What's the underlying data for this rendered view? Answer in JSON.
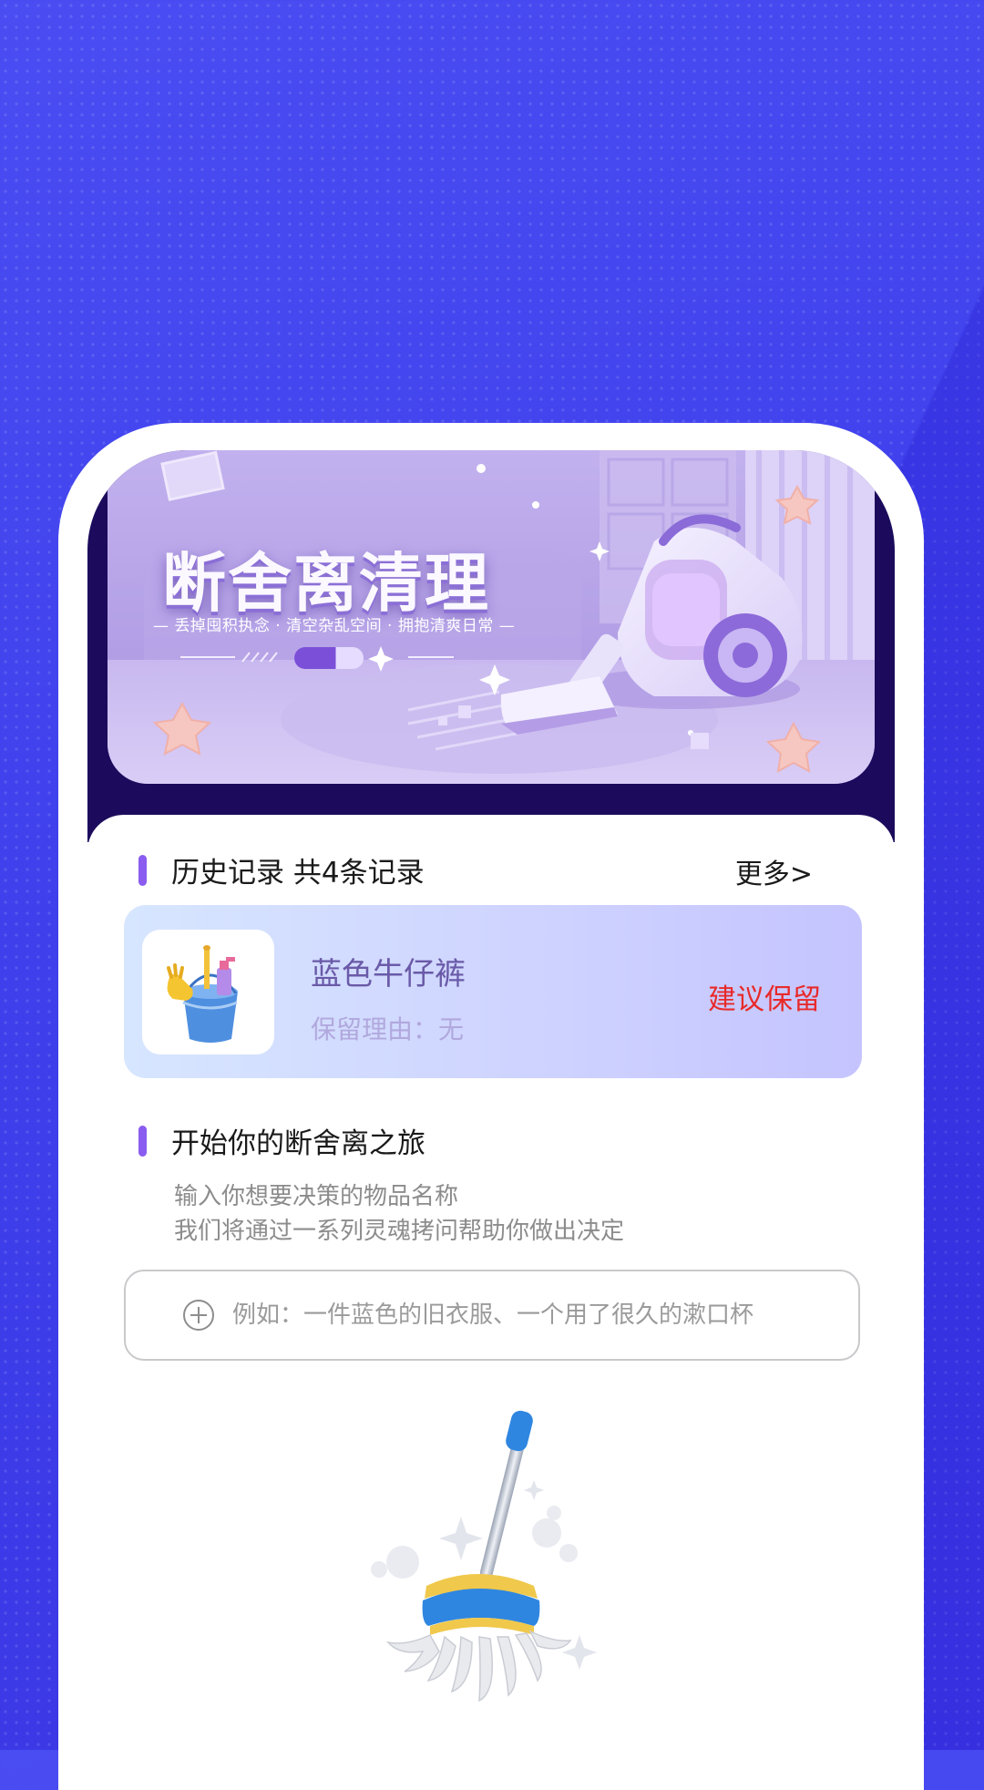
{
  "banner": {
    "title": "断舍离清理",
    "subtitle": "— 丢掉囤积执念 · 清空杂乱空间 · 拥抱清爽日常 —"
  },
  "history": {
    "title": "历史记录  共4条记录",
    "more_label": "更多>",
    "items": [
      {
        "name": "蓝色牛仔裤",
        "reason": "保留理由：无",
        "verdict": "建议保留",
        "thumb_icon": "cleaning-bucket-icon"
      }
    ]
  },
  "journey": {
    "title": "开始你的断舍离之旅",
    "intro_line1": "输入你想要决策的物品名称",
    "intro_line2": "我们将通过一系列灵魂拷问帮助你做出决定"
  },
  "input": {
    "placeholder": "例如：一件蓝色的旧衣服、一个用了很久的漱口杯",
    "value": ""
  },
  "illustration": {
    "icon": "mop-icon"
  },
  "colors": {
    "background": "#4346ee",
    "accent_bar": "#8a5cf0",
    "verdict": "#e82a2a",
    "item_name": "#6a5aa8"
  }
}
